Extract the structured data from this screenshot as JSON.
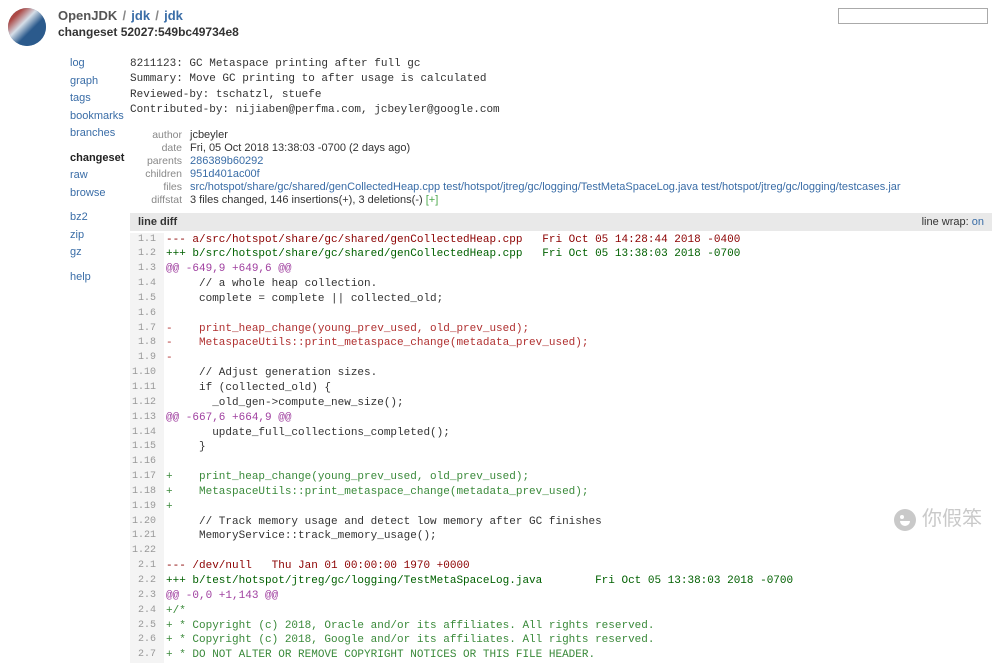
{
  "header": {
    "project": "OpenJDK",
    "repo": "jdk",
    "sub": "jdk",
    "changeset": "changeset 52027:549bc49734e8"
  },
  "search": {
    "placeholder": ""
  },
  "nav": {
    "block1": [
      "log",
      "graph",
      "tags",
      "bookmarks",
      "branches"
    ],
    "block2": [
      "changeset",
      "raw",
      "browse"
    ],
    "block3": [
      "bz2",
      "zip",
      "gz"
    ],
    "block4": [
      "help"
    ],
    "current": "changeset"
  },
  "commit_msg": [
    "8211123: GC Metaspace printing after full gc",
    "Summary: Move GC printing to after usage is calculated",
    "Reviewed-by: tschatzl, stuefe",
    "Contributed-by: nijiaben@perfma.com, jcbeyler@google.com"
  ],
  "meta": {
    "author_label": "author",
    "author": "jcbeyler",
    "date_label": "date",
    "date": "Fri, 05 Oct 2018 13:38:03 -0700 (2 days ago)",
    "parents_label": "parents",
    "parents": "286389b60292",
    "children_label": "children",
    "children": "951d401ac00f",
    "files_label": "files",
    "files": [
      "src/hotspot/share/gc/shared/genCollectedHeap.cpp",
      "test/hotspot/jtreg/gc/logging/TestMetaSpaceLog.java",
      "test/hotspot/jtreg/gc/logging/testcases.jar"
    ],
    "diffstat_label": "diffstat",
    "diffstat_text": "3 files changed, 146 insertions(+), 3 deletions(-) ",
    "diffstat_link": "[+]"
  },
  "diff_header": {
    "left": "line diff",
    "wrap_label": "line wrap:",
    "wrap_value": "on"
  },
  "diff": [
    {
      "n": "1.1",
      "cls": "minus-file",
      "t": "--- a/src/hotspot/share/gc/shared/genCollectedHeap.cpp   Fri Oct 05 14:28:44 2018 -0400"
    },
    {
      "n": "1.2",
      "cls": "plus-file",
      "t": "+++ b/src/hotspot/share/gc/shared/genCollectedHeap.cpp   Fri Oct 05 13:38:03 2018 -0700"
    },
    {
      "n": "1.3",
      "cls": "hunk",
      "t": "@@ -649,9 +649,6 @@"
    },
    {
      "n": "1.4",
      "cls": "ctxt",
      "t": "     // a whole heap collection."
    },
    {
      "n": "1.5",
      "cls": "ctxt",
      "t": "     complete = complete || collected_old;"
    },
    {
      "n": "1.6",
      "cls": "ctxt",
      "t": " "
    },
    {
      "n": "1.7",
      "cls": "minus",
      "t": "-    print_heap_change(young_prev_used, old_prev_used);"
    },
    {
      "n": "1.8",
      "cls": "minus",
      "t": "-    MetaspaceUtils::print_metaspace_change(metadata_prev_used);"
    },
    {
      "n": "1.9",
      "cls": "minus",
      "t": "-"
    },
    {
      "n": "1.10",
      "cls": "ctxt",
      "t": "     // Adjust generation sizes."
    },
    {
      "n": "1.11",
      "cls": "ctxt",
      "t": "     if (collected_old) {"
    },
    {
      "n": "1.12",
      "cls": "ctxt",
      "t": "       _old_gen->compute_new_size();"
    },
    {
      "n": "1.13",
      "cls": "hunk",
      "t": "@@ -667,6 +664,9 @@"
    },
    {
      "n": "1.14",
      "cls": "ctxt",
      "t": "       update_full_collections_completed();"
    },
    {
      "n": "1.15",
      "cls": "ctxt",
      "t": "     }"
    },
    {
      "n": "1.16",
      "cls": "ctxt",
      "t": " "
    },
    {
      "n": "1.17",
      "cls": "plus",
      "t": "+    print_heap_change(young_prev_used, old_prev_used);"
    },
    {
      "n": "1.18",
      "cls": "plus",
      "t": "+    MetaspaceUtils::print_metaspace_change(metadata_prev_used);"
    },
    {
      "n": "1.19",
      "cls": "plus",
      "t": "+"
    },
    {
      "n": "1.20",
      "cls": "ctxt",
      "t": "     // Track memory usage and detect low memory after GC finishes"
    },
    {
      "n": "1.21",
      "cls": "ctxt",
      "t": "     MemoryService::track_memory_usage();"
    },
    {
      "n": "1.22",
      "cls": "ctxt",
      "t": " "
    },
    {
      "n": "2.1",
      "cls": "minus-file",
      "t": "--- /dev/null   Thu Jan 01 00:00:00 1970 +0000"
    },
    {
      "n": "2.2",
      "cls": "plus-file",
      "t": "+++ b/test/hotspot/jtreg/gc/logging/TestMetaSpaceLog.java        Fri Oct 05 13:38:03 2018 -0700"
    },
    {
      "n": "2.3",
      "cls": "hunk",
      "t": "@@ -0,0 +1,143 @@"
    },
    {
      "n": "2.4",
      "cls": "plus",
      "t": "+/*"
    },
    {
      "n": "2.5",
      "cls": "plus",
      "t": "+ * Copyright (c) 2018, Oracle and/or its affiliates. All rights reserved."
    },
    {
      "n": "2.6",
      "cls": "plus",
      "t": "+ * Copyright (c) 2018, Google and/or its affiliates. All rights reserved."
    },
    {
      "n": "2.7",
      "cls": "plus",
      "t": "+ * DO NOT ALTER OR REMOVE COPYRIGHT NOTICES OR THIS FILE HEADER."
    }
  ],
  "watermark": "你假笨"
}
